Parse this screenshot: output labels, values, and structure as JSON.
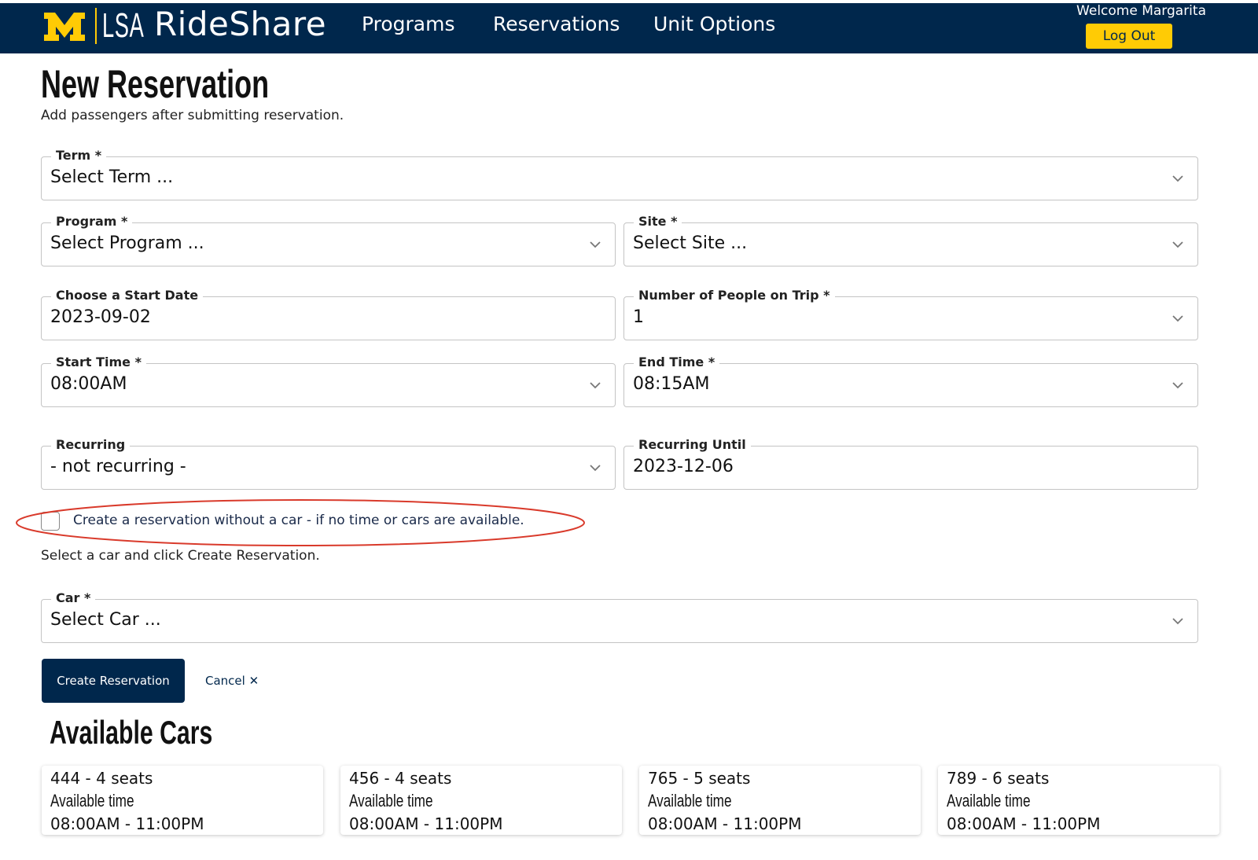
{
  "header": {
    "brand_lsa": "LSA",
    "brand_name": "RideShare",
    "nav": [
      "Programs",
      "Reservations",
      "Unit Options"
    ],
    "welcome": "Welcome Margarita",
    "logout_label": "Log Out",
    "colors": {
      "bar": "#00274c",
      "maize": "#ffcb05"
    }
  },
  "page": {
    "title": "New Reservation",
    "subtitle": "Add passengers after submitting reservation."
  },
  "form": {
    "term": {
      "label": "Term *",
      "value": "Select Term ..."
    },
    "program": {
      "label": "Program *",
      "value": "Select Program ..."
    },
    "site": {
      "label": "Site *",
      "value": "Select Site ..."
    },
    "start_date": {
      "label": "Choose a Start Date",
      "value": "2023-09-02"
    },
    "num_people": {
      "label": "Number of People on Trip *",
      "value": "1"
    },
    "start_time": {
      "label": "Start Time *",
      "value": "08:00AM"
    },
    "end_time": {
      "label": "End Time *",
      "value": "08:15AM"
    },
    "recurring": {
      "label": "Recurring",
      "value": "- not recurring -"
    },
    "recurring_until": {
      "label": "Recurring Until",
      "value": "2023-12-06"
    },
    "no_car_checkbox": {
      "label": "Create a reservation without a car - if no time or cars are available.",
      "checked": false
    },
    "car_hint": "Select a car and click Create Reservation.",
    "car": {
      "label": "Car *",
      "value": "Select Car ..."
    },
    "submit_label": "Create Reservation",
    "cancel_label": "Cancel ✕"
  },
  "available_cars": {
    "title": "Available Cars",
    "cars": [
      {
        "name": "444 - 4 seats",
        "avail_label": "Available time",
        "time": "08:00AM - 11:00PM"
      },
      {
        "name": "456 - 4 seats",
        "avail_label": "Available time",
        "time": "08:00AM - 11:00PM"
      },
      {
        "name": "765 - 5 seats",
        "avail_label": "Available time",
        "time": "08:00AM - 11:00PM"
      },
      {
        "name": "789 - 6 seats",
        "avail_label": "Available time",
        "time": "08:00AM - 11:00PM"
      }
    ]
  },
  "annotation_color": "#d93a2b"
}
